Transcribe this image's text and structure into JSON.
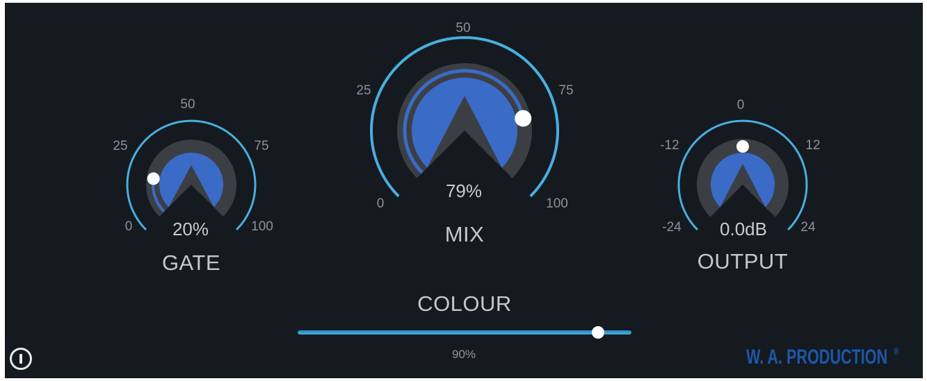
{
  "knobs": {
    "gate": {
      "name": "GATE",
      "value": "20%",
      "fraction": 0.2,
      "ticks": {
        "low": "0",
        "q1": "25",
        "mid": "50",
        "q3": "75",
        "high": "100"
      }
    },
    "mix": {
      "name": "MIX",
      "value": "79%",
      "fraction": 0.79,
      "ticks": {
        "low": "0",
        "q1": "25",
        "mid": "50",
        "q3": "75",
        "high": "100"
      }
    },
    "output": {
      "name": "OUTPUT",
      "value": "0.0dB",
      "fraction": 0.5,
      "ticks": {
        "low": "-24",
        "q1": "-12",
        "mid": "0",
        "q3": "12",
        "high": "24"
      }
    }
  },
  "colour": {
    "name": "COLOUR",
    "value": "90%",
    "fraction": 0.9
  },
  "power": {
    "icon": "power-icon"
  },
  "brand": {
    "text": "W. A. PRODUCTION",
    "mark": "®"
  },
  "colors": {
    "background": "#141a20",
    "ring": "#4aaee0",
    "disk": "#3a6bc7",
    "groove": "#3b3f44",
    "brand": "#1d57a8"
  }
}
